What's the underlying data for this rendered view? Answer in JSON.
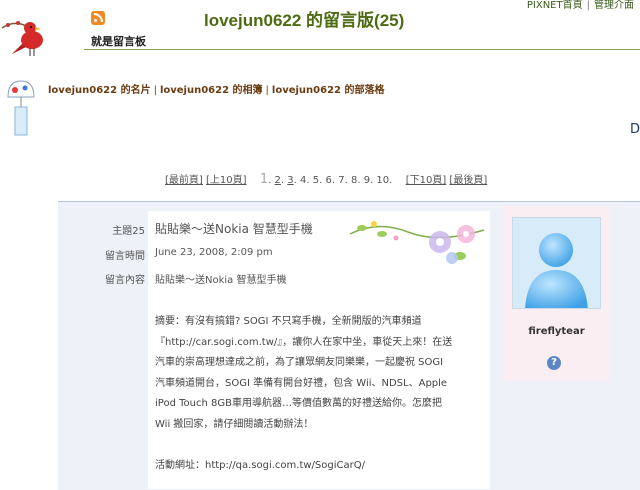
{
  "top_links": [
    "PIXNET首頁",
    "管理介面"
  ],
  "header": {
    "title": "lovejun0622 的留言版(25)",
    "subtitle": "就是留言板"
  },
  "nav": {
    "links": [
      "lovejun0622 的名片",
      "lovejun0622 的相簿",
      "lovejun0622 的部落格"
    ],
    "edge_char": "D"
  },
  "pager": {
    "first": "[最前頁]",
    "prev10": "[上10頁]",
    "pages": [
      "1",
      "2",
      "3",
      "4",
      "5",
      "6",
      "7",
      "8",
      "9",
      "10"
    ],
    "current": "1",
    "next10": "[下10頁]",
    "last": "[最後頁]"
  },
  "message": {
    "subject_label": "主題25",
    "subject": "貼貼樂～送Nokia 智慧型手機",
    "time_label": "留言時間",
    "time": "June 23, 2008, 2:09 pm",
    "content_label": "留言內容",
    "content_title": "貼貼樂～送Nokia 智慧型手機",
    "body_lines": [
      "摘要：有沒有搞錯? SOGI 不只寫手機，全新開版的汽車頻道",
      "『http://car.sogi.com.tw/』，讓你人在家中坐，車從天上來！在送",
      "汽車的崇高理想達成之前，為了讓眾網友同樂樂，一起慶祝 SOGI",
      "汽車頻道開台，SOGI 準備有開台好禮，包含 Wii、NDSL、Apple",
      "iPod Touch 8GB車用導航器…等價值數萬的好禮送給你。怎麼把",
      "Wii 搬回家，請仔細閱讀活動辦法！",
      "",
      "活動網址：http://qa.sogi.com.tw/SogiCarQ/"
    ]
  },
  "author": {
    "name": "fireflytear"
  },
  "icons": {
    "rss": "rss-icon",
    "bird": "red-bird-icon",
    "bell": "wind-chime-icon",
    "avatar": "default-avatar-icon",
    "info": "info-icon"
  },
  "colors": {
    "title": "#4d6b12",
    "nav": "#6b3b10",
    "panel": "#eef1f8",
    "avatar_panel": "#fbeef2"
  }
}
